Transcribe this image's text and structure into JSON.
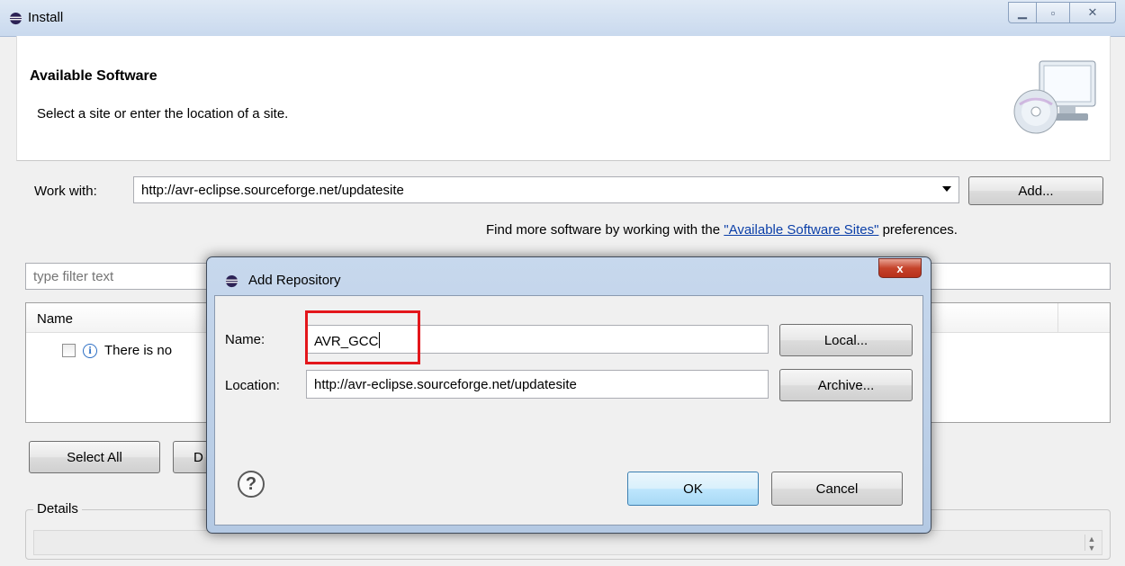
{
  "window": {
    "title": "Install",
    "controls": {
      "minimize": "▁",
      "maximize": "▫",
      "close": "✕"
    }
  },
  "header": {
    "title": "Available Software",
    "subtitle": "Select a site or enter the location of a site."
  },
  "work_with": {
    "label": "Work with:",
    "value": "http://avr-eclipse.sourceforge.net/updatesite",
    "add_button": "Add..."
  },
  "find_more": {
    "prefix": "Find more software by working with the ",
    "link": "\"Available Software Sites\"",
    "suffix": " preferences."
  },
  "filter": {
    "placeholder": "type filter text"
  },
  "tree": {
    "column_name": "Name",
    "row_text": "There is no"
  },
  "buttons": {
    "select_all": "Select All",
    "deselect_partial": "D"
  },
  "details": {
    "label": "Details"
  },
  "dialog": {
    "title": "Add Repository",
    "close": "x",
    "name_label": "Name:",
    "name_value": "AVR_GCC",
    "location_label": "Location:",
    "location_value": "http://avr-eclipse.sourceforge.net/updatesite",
    "local_button": "Local...",
    "archive_button": "Archive...",
    "ok_button": "OK",
    "cancel_button": "Cancel",
    "help": "?"
  },
  "colors": {
    "highlight_box": "#e3161b",
    "link": "#0b3fa8"
  }
}
